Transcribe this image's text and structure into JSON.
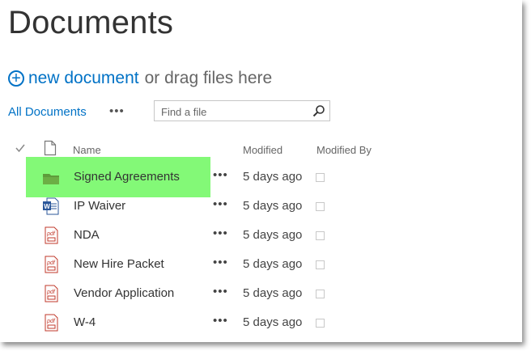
{
  "page": {
    "title": "Documents"
  },
  "command": {
    "new_label": "new document",
    "drag_label": "or drag files here"
  },
  "view": {
    "name": "All Documents",
    "more": "•••"
  },
  "search": {
    "placeholder": "Find a file"
  },
  "columns": {
    "name": "Name",
    "modified": "Modified",
    "modified_by": "Modified By"
  },
  "rows": [
    {
      "name": "Signed Agreements",
      "type": "folder",
      "modified": "5 days ago",
      "highlighted": true
    },
    {
      "name": "IP Waiver",
      "type": "word",
      "modified": "5 days ago"
    },
    {
      "name": "NDA",
      "type": "pdf",
      "modified": "5 days ago"
    },
    {
      "name": "New Hire Packet",
      "type": "pdf",
      "modified": "5 days ago"
    },
    {
      "name": "Vendor Application",
      "type": "pdf",
      "modified": "5 days ago"
    },
    {
      "name": "W-4",
      "type": "pdf",
      "modified": "5 days ago"
    }
  ],
  "row_more": "•••",
  "icons": {
    "word_letter": "W",
    "pdf_letter": "pdf"
  },
  "colors": {
    "accent": "#0072c6",
    "highlight": "#83f977",
    "folder": "#6cae45",
    "pdf": "#c0392b",
    "word": "#2b579a"
  }
}
